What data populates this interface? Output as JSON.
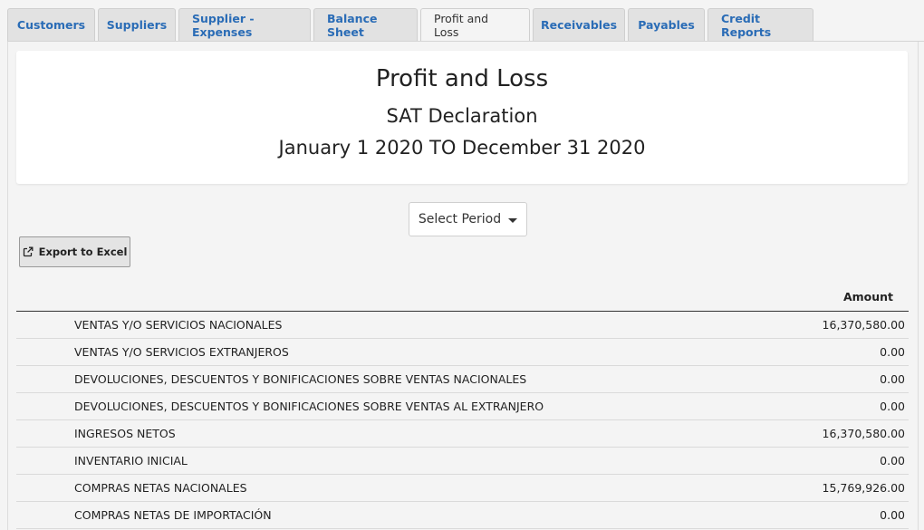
{
  "tabs": [
    {
      "label": "Customers",
      "active": false
    },
    {
      "label": "Suppliers",
      "active": false
    },
    {
      "label": "Supplier - Expenses",
      "active": false
    },
    {
      "label": "Balance Sheet",
      "active": false
    },
    {
      "label": "Profit and Loss",
      "active": true
    },
    {
      "label": "Receivables",
      "active": false
    },
    {
      "label": "Payables",
      "active": false
    },
    {
      "label": "Credit Reports",
      "active": false
    }
  ],
  "report": {
    "title": "Profit and Loss",
    "subtitle": "SAT Declaration",
    "range": "January 1 2020 TO December 31 2020"
  },
  "controls": {
    "select_period_label": "Select Period",
    "export_label": "Export to Excel"
  },
  "table": {
    "amount_header": "Amount",
    "rows": [
      {
        "label": "VENTAS Y/O SERVICIOS NACIONALES",
        "amount": "16,370,580.00"
      },
      {
        "label": "VENTAS Y/O SERVICIOS EXTRANJEROS",
        "amount": "0.00"
      },
      {
        "label": "DEVOLUCIONES, DESCUENTOS Y BONIFICACIONES SOBRE VENTAS NACIONALES",
        "amount": "0.00"
      },
      {
        "label": "DEVOLUCIONES, DESCUENTOS Y BONIFICACIONES SOBRE VENTAS AL EXTRANJERO",
        "amount": "0.00"
      },
      {
        "label": "INGRESOS NETOS",
        "amount": "16,370,580.00"
      },
      {
        "label": "INVENTARIO INICIAL",
        "amount": "0.00"
      },
      {
        "label": "COMPRAS NETAS NACIONALES",
        "amount": "15,769,926.00"
      },
      {
        "label": "COMPRAS NETAS DE IMPORTACIÓN",
        "amount": "0.00"
      }
    ]
  },
  "colors": {
    "tab_link": "#2a6cb6",
    "background": "#f4f4f4"
  }
}
